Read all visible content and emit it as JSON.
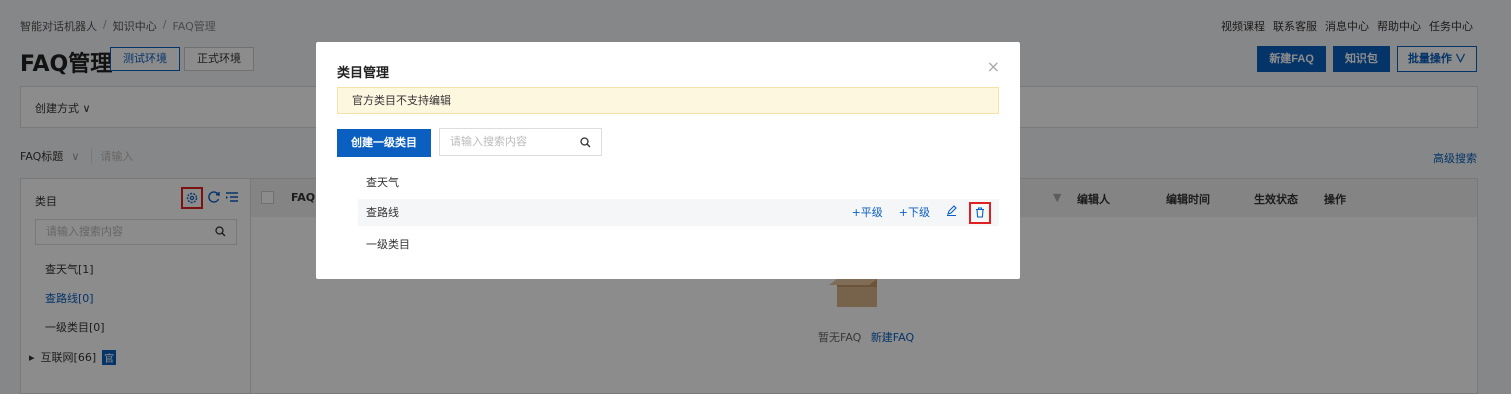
{
  "breadcrumb": [
    "智能对话机器人",
    "知识中心",
    "FAQ管理"
  ],
  "top_links": [
    "视频课程",
    "联系客服",
    "消息中心",
    "帮助中心",
    "任务中心"
  ],
  "page_title": "FAQ管理",
  "env_tabs": [
    "测试环境",
    "正式环境"
  ],
  "head_actions": {
    "new_faq": "新建FAQ",
    "knowledge_pack": "知识包",
    "batch": "批量操作"
  },
  "create_method": "创建方式",
  "filter": {
    "label": "FAQ标题",
    "placeholder": "请输入",
    "advanced": "高级搜索"
  },
  "side": {
    "title": "类目",
    "search_placeholder": "请输入搜索内容",
    "items": [
      "查天气[1]",
      "查路线[0]",
      "一级类目[0]"
    ],
    "tree_item": "互联网[66]",
    "tree_badge": "官"
  },
  "table": {
    "headers": [
      "FAQ",
      "编辑人",
      "编辑时间",
      "生效状态",
      "操作"
    ],
    "empty_text": "暂无FAQ",
    "empty_link": "新建FAQ"
  },
  "modal": {
    "title": "类目管理",
    "close": "×",
    "notice": "官方类目不支持编辑",
    "create_button": "创建一级类目",
    "search_placeholder": "请输入搜索内容",
    "rows": [
      "查天气",
      "查路线",
      "一级类目"
    ],
    "row_actions": {
      "sibling": "+平级",
      "child": "+下级"
    }
  },
  "colors": {
    "primary": "#0a5fc0",
    "highlight": "#e02020",
    "notice_bg": "#fef7e0"
  }
}
